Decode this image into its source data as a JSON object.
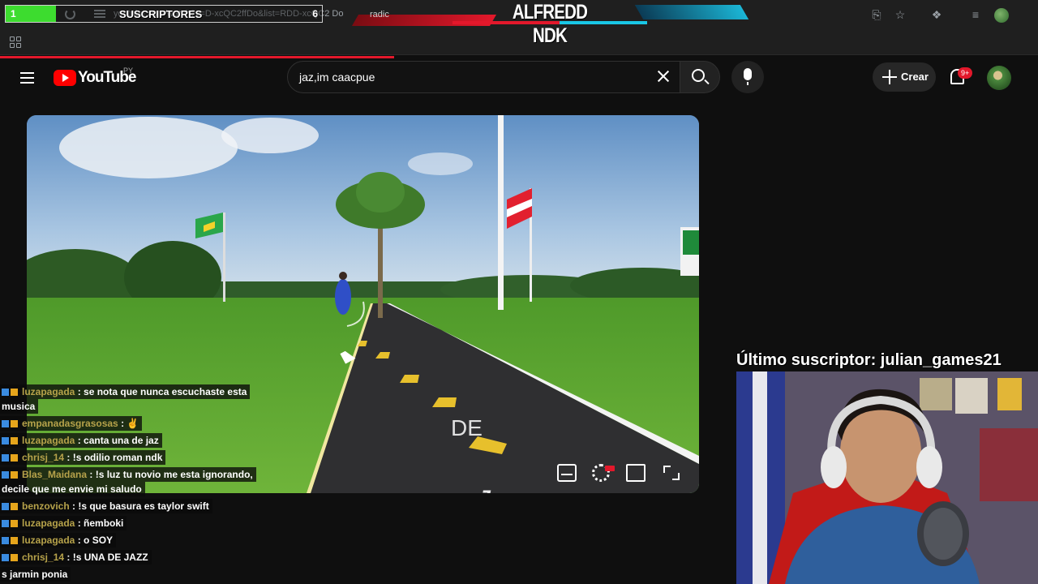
{
  "stream_overlay": {
    "subs_count": "1",
    "subs_label": "SUSCRIPTORES",
    "subs_goal": "6",
    "subs_progress": 0.16,
    "banner_title": "ALFREDD NDK",
    "banner_tab": "radic",
    "last_subscriber": "Último suscriptor: julian_games21"
  },
  "browser": {
    "url": "youtube.com/watch?v=D-xcQC2ffDo&list=RDD-xcQC2 Do",
    "icons": [
      "reload-icon",
      "tune-icon",
      "install-icon",
      "star-icon",
      "extensions-icon",
      "media-icon",
      "profile-icon",
      "apps-icon"
    ]
  },
  "youtube": {
    "wordmark": "YouTube",
    "region": "PY",
    "search_query": "jaz,im caacpue",
    "create_label": "Crear",
    "notifications": "9+"
  },
  "video": {
    "overlay_letter": "J",
    "overlay_text": "DE"
  },
  "chat": [
    {
      "user": "luzapagada",
      "msg": ": se nota que nunca escuchaste esta"
    },
    {
      "user": "",
      "msg": "musica"
    },
    {
      "user": "empanadasgrasosas",
      "msg": ": ✌"
    },
    {
      "user": "luzapagada",
      "msg": ": canta una de jaz"
    },
    {
      "user": "chrisj_14",
      "msg": ": !s odilio roman ndk"
    },
    {
      "user": "Blas_Maidana",
      "msg": ": !s luz tu novio me esta ignorando,"
    },
    {
      "user": "",
      "msg": "decile que me envie mi saludo"
    },
    {
      "user": "benzovich",
      "msg": ": !s que basura es taylor swift"
    },
    {
      "user": "luzapagada",
      "msg": ": ñemboki"
    },
    {
      "user": "luzapagada",
      "msg": ": o SOY"
    },
    {
      "user": "chrisj_14",
      "msg": ": !s UNA DE JAZZ"
    },
    {
      "user": "",
      "msg": "s jarmin ponia"
    }
  ]
}
